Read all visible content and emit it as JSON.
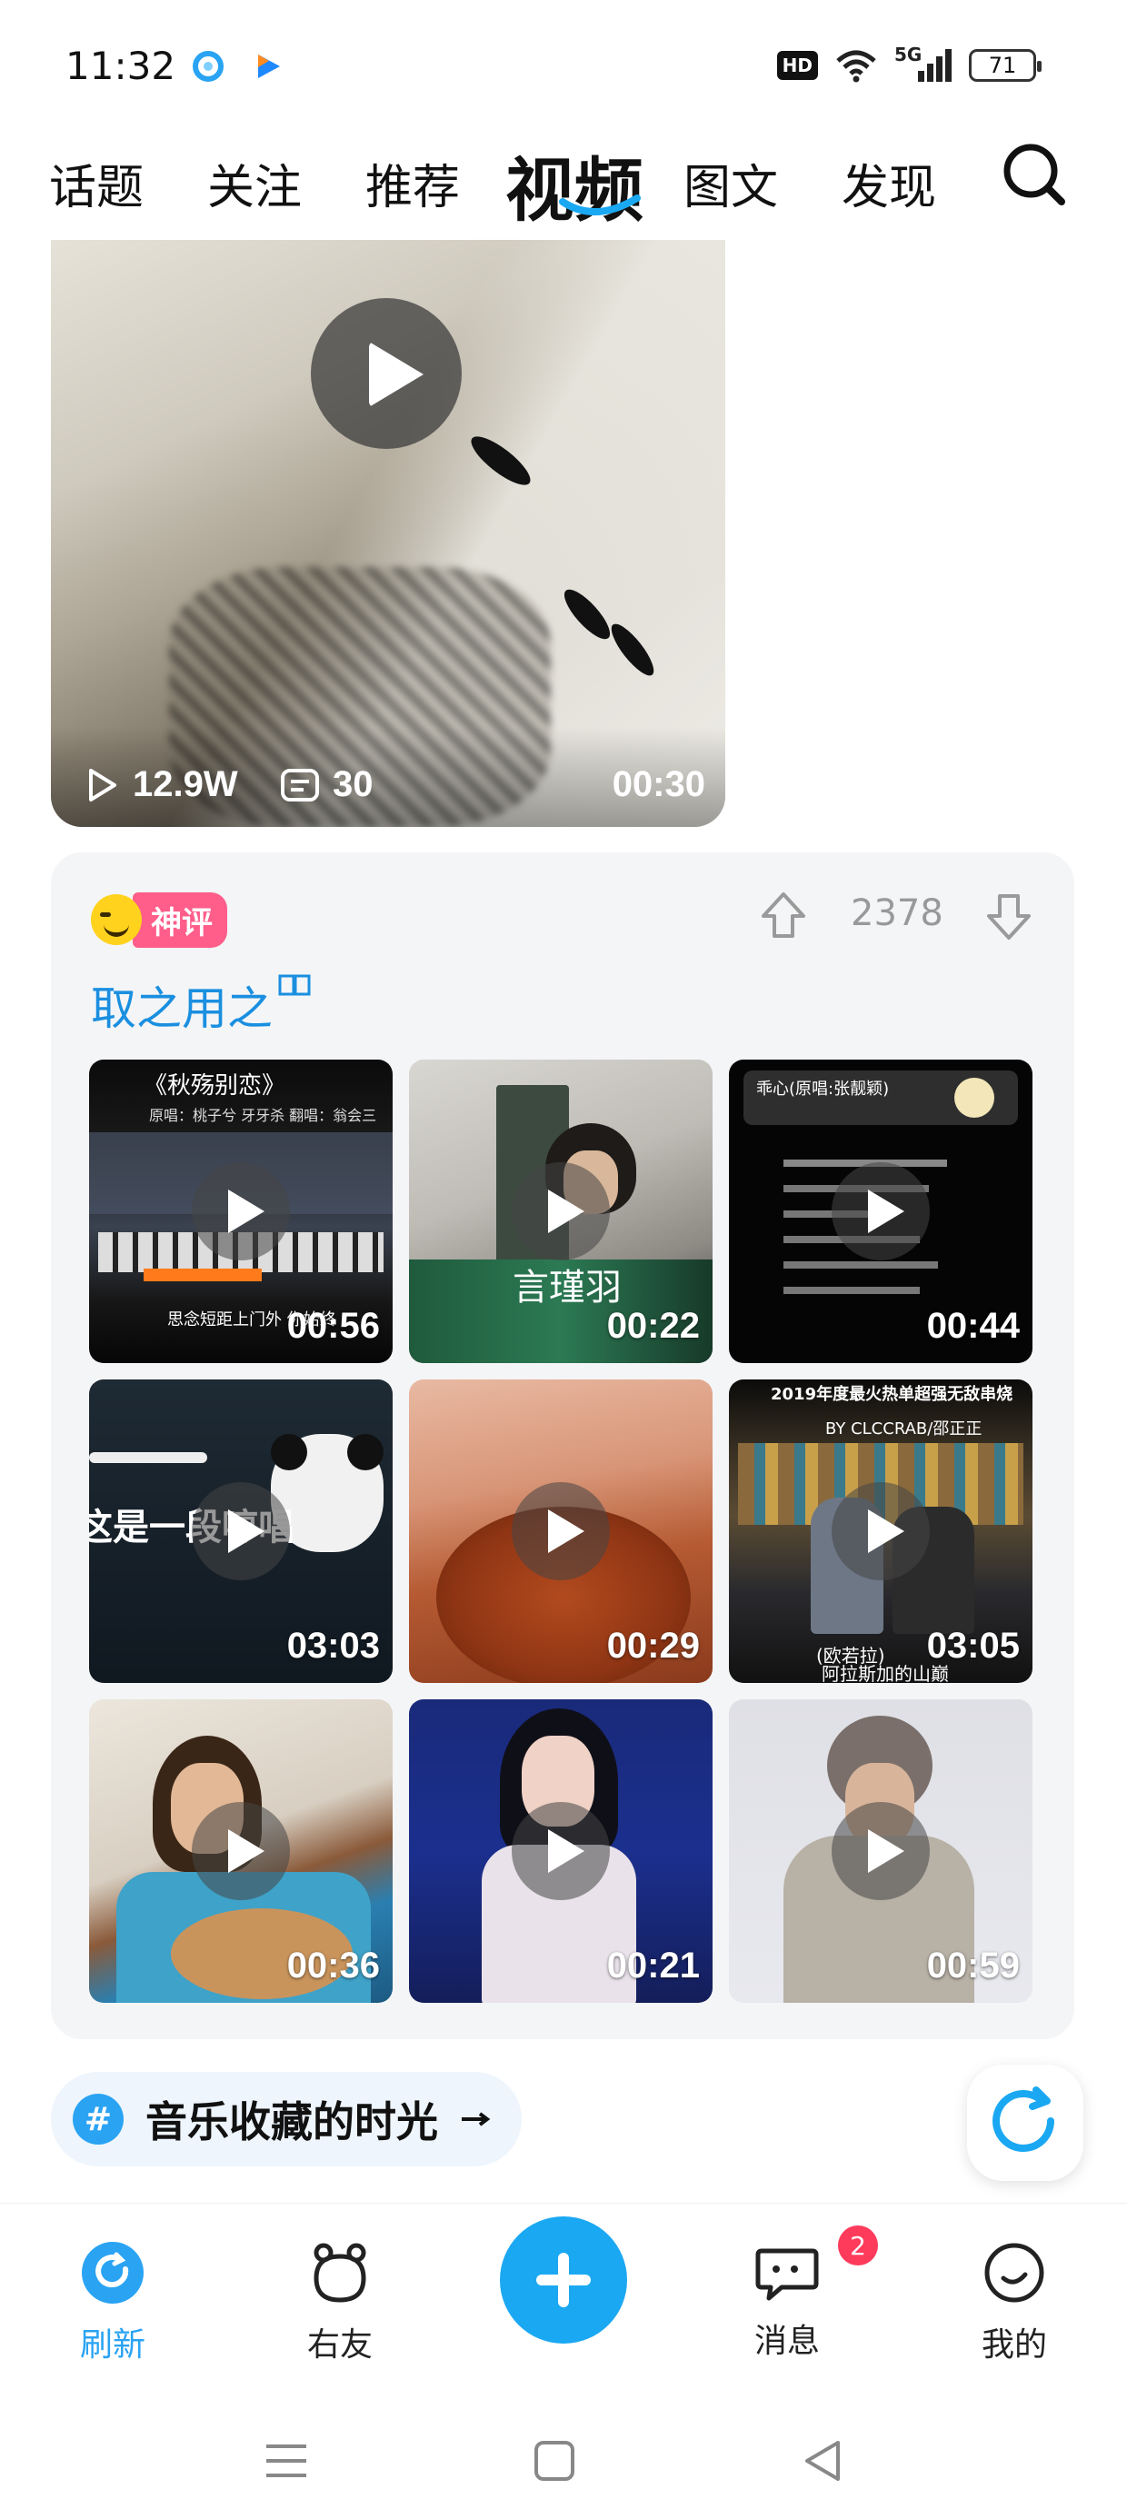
{
  "status_bar": {
    "time": "11:32",
    "hd": "HD",
    "network": "5G",
    "battery": "71"
  },
  "tabs": [
    {
      "label": "话题"
    },
    {
      "label": "关注"
    },
    {
      "label": "推荐"
    },
    {
      "label": "视频",
      "active": true
    },
    {
      "label": "图文"
    },
    {
      "label": "发现"
    }
  ],
  "main_video": {
    "plays": "12.9W",
    "comments": "30",
    "duration": "00:30"
  },
  "comment_card": {
    "badge": "神评",
    "vote_count": "2378",
    "text": "取之用之",
    "thumbnails": [
      {
        "duration": "00:56",
        "caption_top": "《秋殇别恋》",
        "caption_sub": "原唱：桃子兮 牙牙杀          翻唱：翁会三",
        "caption_bottom": "思念短距上门外 你始终"
      },
      {
        "duration": "00:22",
        "caption_mid": "言瑾羽"
      },
      {
        "duration": "00:44",
        "caption_top": "乖心(原唱:张靓颖)"
      },
      {
        "duration": "03:03",
        "caption_mid": "这是一段哼唱"
      },
      {
        "duration": "00:29"
      },
      {
        "duration": "03:05",
        "caption_top": "2019年度最火热单超强无敌串烧",
        "caption_sub": "BY CLCCRAB/邵正正",
        "caption_bottom": "阿拉斯加的山巅",
        "caption_bottom2": "(欧若拉)"
      },
      {
        "duration": "00:36"
      },
      {
        "duration": "00:21"
      },
      {
        "duration": "00:59"
      }
    ]
  },
  "hashtag": {
    "symbol": "#",
    "text": "音乐收藏的时光"
  },
  "bottom_nav": {
    "refresh": "刷新",
    "friends": "右友",
    "messages": "消息",
    "messages_badge": "2",
    "me": "我的"
  },
  "colors": {
    "accent": "#1ba8f2",
    "comment_text": "#1a8fe0",
    "badge_pink": "#ff5d8a",
    "notification": "#ff3b5c"
  }
}
